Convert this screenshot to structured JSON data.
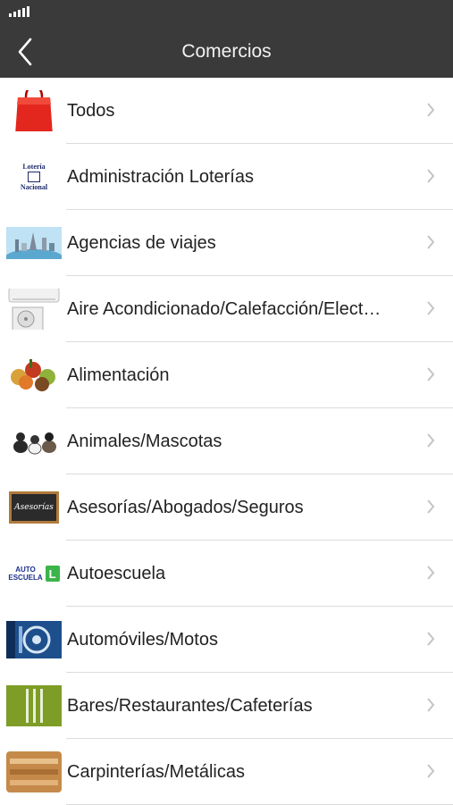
{
  "header": {
    "title": "Comercios",
    "back_icon": "chevron-left-icon"
  },
  "colors": {
    "bar": "#3a3a3a",
    "separator": "#dcdcdc",
    "chevron": "#c4c4c8"
  },
  "items": [
    {
      "label": "Todos",
      "icon": "shopping-bag-icon"
    },
    {
      "label": "Administración Loterías",
      "icon": "loteria-nacional-logo",
      "logo_text": [
        "Lotería",
        "Nacional"
      ]
    },
    {
      "label": "Agencias de viajes",
      "icon": "travel-landmarks-icon"
    },
    {
      "label": "Aire Acondicionado/Calefacción/Elect…",
      "icon": "air-conditioner-icon"
    },
    {
      "label": "Alimentación",
      "icon": "food-basket-icon"
    },
    {
      "label": "Animales/Mascotas",
      "icon": "pets-icon"
    },
    {
      "label": "Asesorías/Abogados/Seguros",
      "icon": "chalkboard-icon",
      "board_text": "Asesorías"
    },
    {
      "label": "Autoescuela",
      "icon": "driving-school-logo",
      "logo_text": [
        "AUTO",
        "ESCUELA"
      ]
    },
    {
      "label": "Automóviles/Motos",
      "icon": "car-parts-icon"
    },
    {
      "label": "Bares/Restaurantes/Cafeterías",
      "icon": "cutlery-icon"
    },
    {
      "label": "Carpinterías/Metálicas",
      "icon": "carpentry-tools-icon"
    }
  ]
}
